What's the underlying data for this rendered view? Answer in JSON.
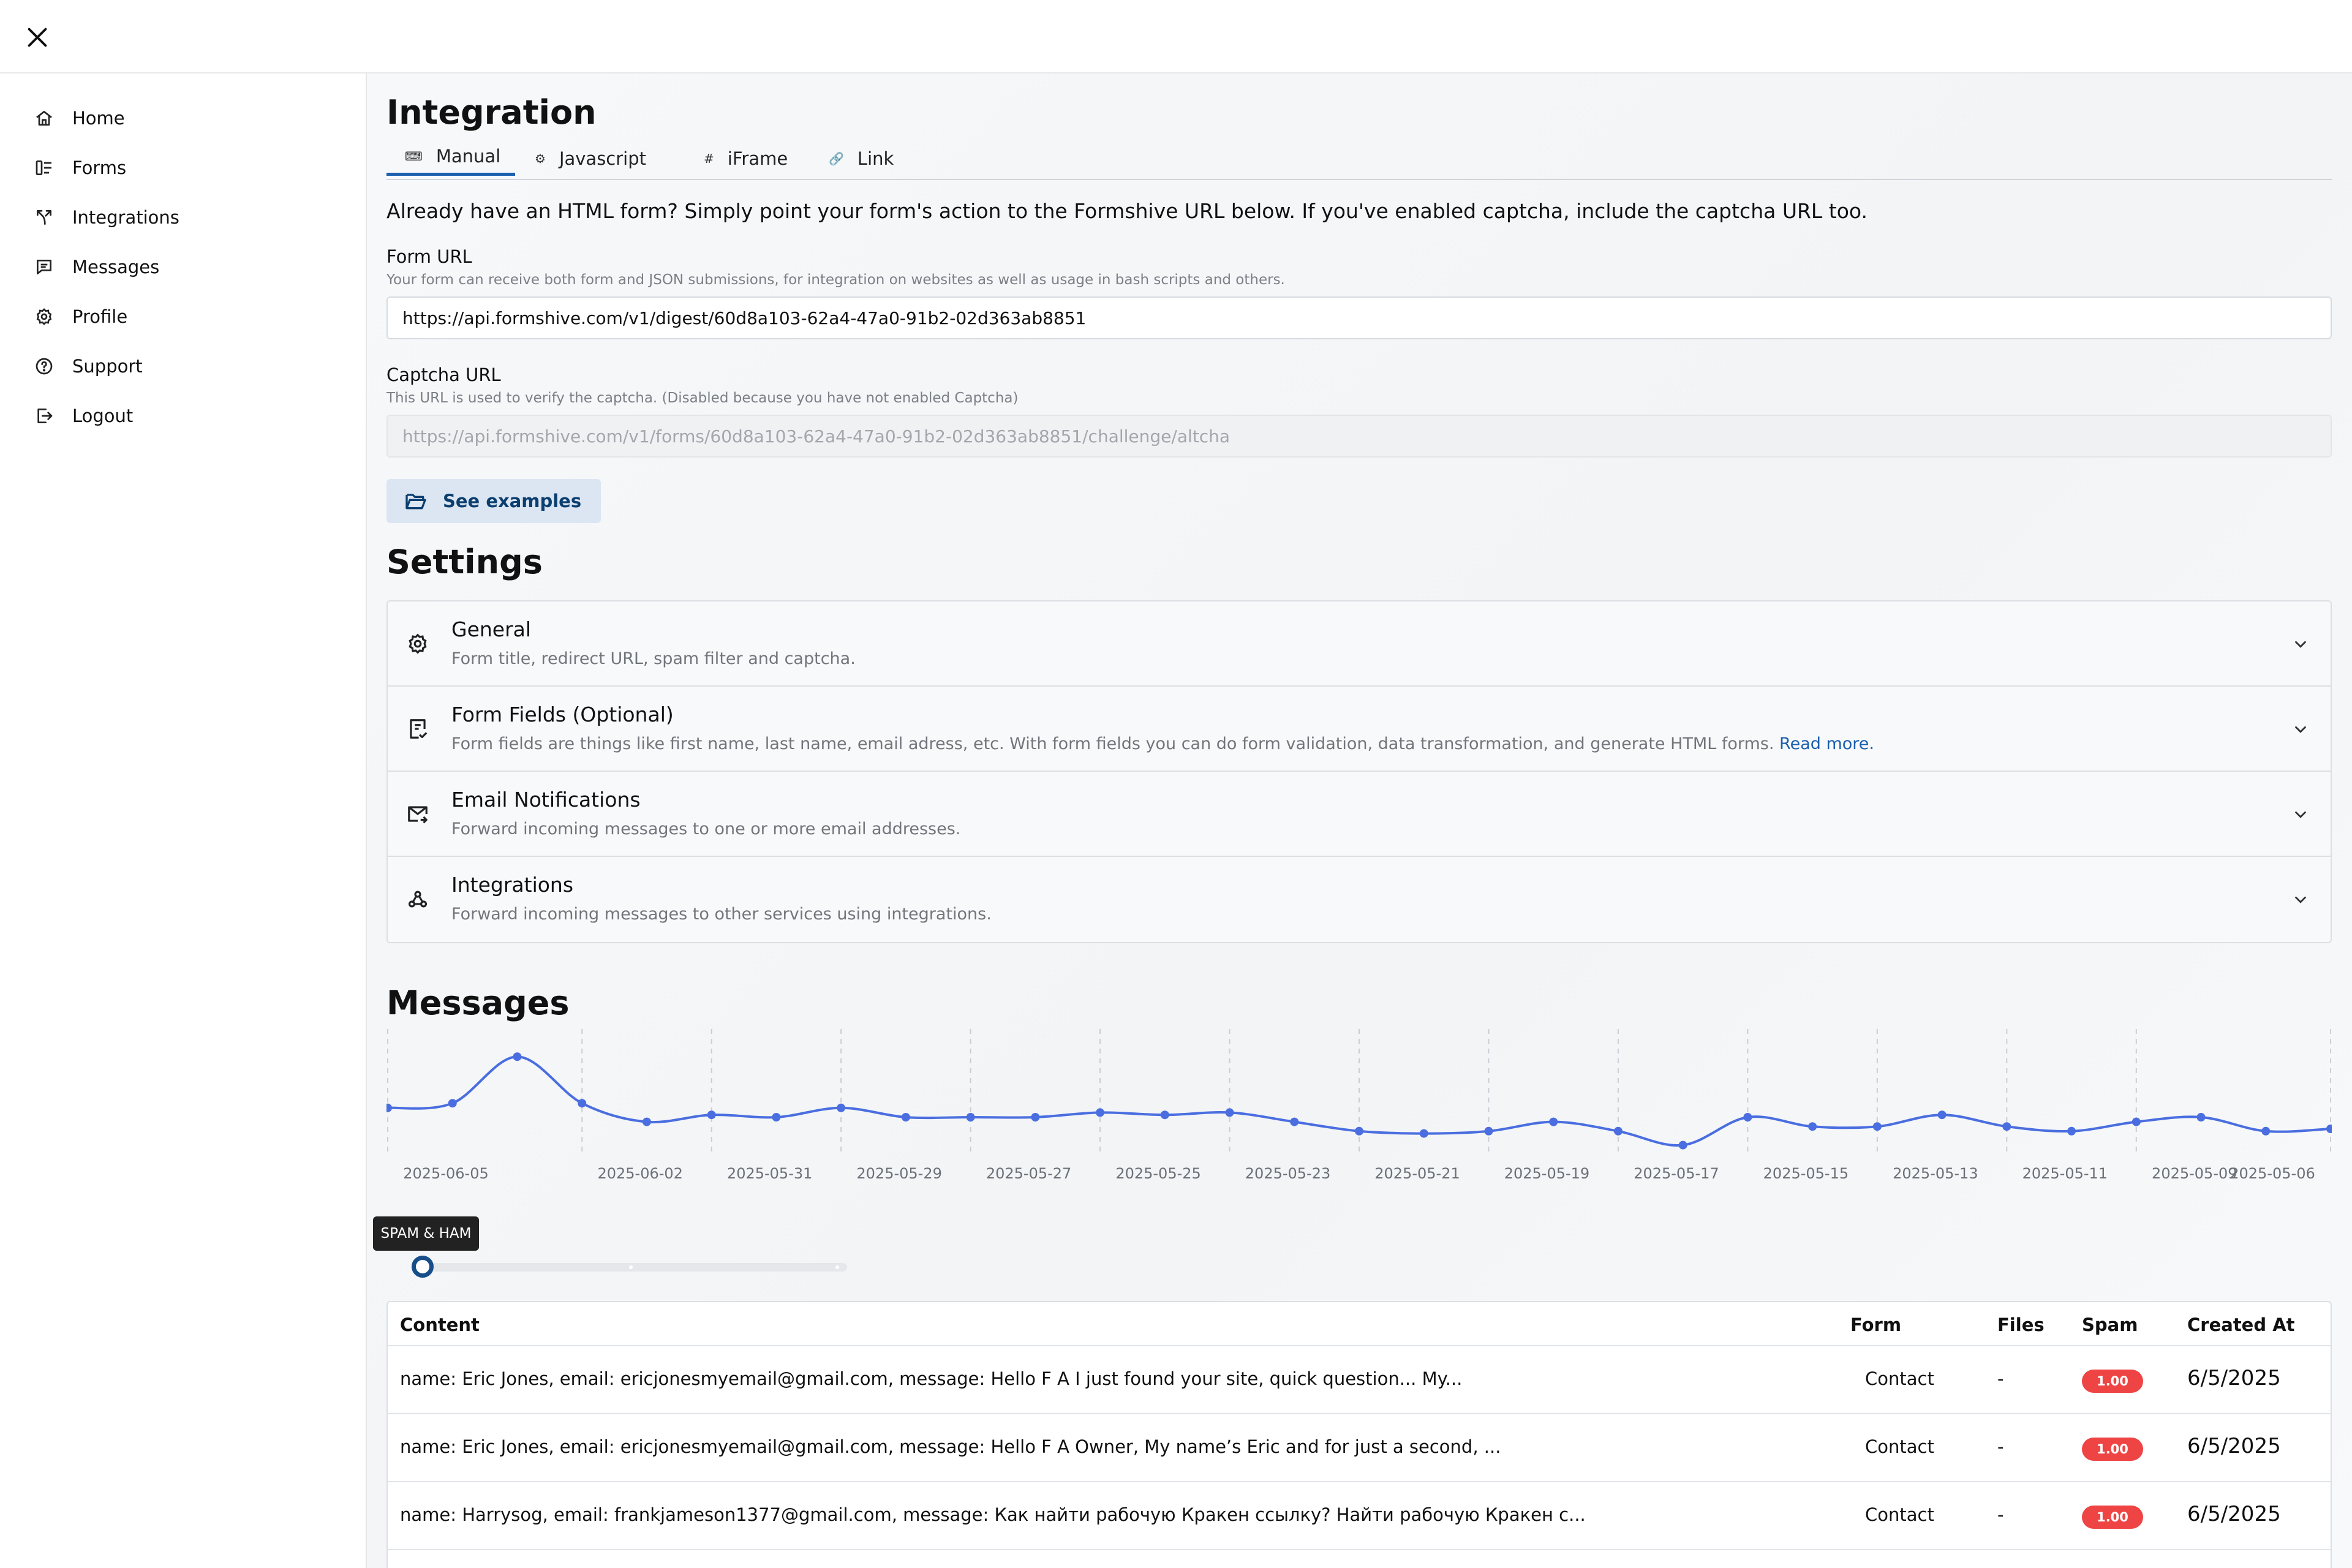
{
  "sidebar": {
    "items": [
      {
        "label": "Home",
        "icon": "home-icon"
      },
      {
        "label": "Forms",
        "icon": "forms-icon"
      },
      {
        "label": "Integrations",
        "icon": "integrations-icon"
      },
      {
        "label": "Messages",
        "icon": "messages-icon"
      },
      {
        "label": "Profile",
        "icon": "gear-icon"
      },
      {
        "label": "Support",
        "icon": "help-circle-icon"
      },
      {
        "label": "Logout",
        "icon": "logout-icon"
      }
    ]
  },
  "integration": {
    "title": "Integration",
    "tabs": [
      {
        "label": "Manual",
        "active": true
      },
      {
        "label": "Javascript"
      },
      {
        "label": "iFrame"
      },
      {
        "label": "Link"
      }
    ],
    "lead": "Already have an HTML form? Simply point your form's action to the Formshive URL below. If you've enabled captcha, include the captcha URL too.",
    "form_url_label": "Form URL",
    "form_url_help": "Your form can receive both form and JSON submissions, for integration on websites as well as usage in bash scripts and others.",
    "form_url_value": "https://api.formshive.com/v1/digest/60d8a103-62a4-47a0-91b2-02d363ab8851",
    "captcha_url_label": "Captcha URL",
    "captcha_url_help": "This URL is used to verify the captcha. (Disabled because you have not enabled Captcha)",
    "captcha_url_value": "https://api.formshive.com/v1/forms/60d8a103-62a4-47a0-91b2-02d363ab8851/challenge/altcha",
    "examples_button": "See examples"
  },
  "settings": {
    "title": "Settings",
    "sections": [
      {
        "title": "General",
        "desc": "Form title, redirect URL, spam filter and captcha.",
        "icon": "gear-icon"
      },
      {
        "title": "Form Fields (Optional)",
        "desc": "Form fields are things like first name, last name, email adress, etc. With form fields you can do form validation, data transformation, and generate HTML forms.",
        "link": "Read more.",
        "icon": "form-check-icon"
      },
      {
        "title": "Email Notifications",
        "desc": "Forward incoming messages to one or more email addresses.",
        "icon": "mail-forward-icon"
      },
      {
        "title": "Integrations",
        "desc": "Forward incoming messages to other services using integrations.",
        "icon": "webhook-icon"
      }
    ]
  },
  "messages": {
    "title": "Messages",
    "filter_label": "SPAM & HAM",
    "filter_value_index": 0,
    "table": {
      "columns": [
        "Content",
        "Form",
        "Files",
        "Spam",
        "Created At"
      ],
      "rows": [
        {
          "content": "name: Eric Jones, email: ericjonesmyemail@gmail.com, message: Hello F A  I just found your site, quick question...  My...",
          "form": "Contact",
          "files": "-",
          "spam": "1.00",
          "created": "6/5/2025"
        },
        {
          "content": "name: Eric Jones, email: ericjonesmyemail@gmail.com, message: Hello F A Owner,  My name’s Eric and for just a second, ...",
          "form": "Contact",
          "files": "-",
          "spam": "1.00",
          "created": "6/5/2025"
        },
        {
          "content": "name: Harrysog, email: frankjameson1377@gmail.com, message: Как найти рабочую Кракен ссылку?   Найти рабочую Кракен с...",
          "form": "Contact",
          "files": "-",
          "spam": "1.00",
          "created": "6/5/2025"
        }
      ]
    }
  },
  "colors": {
    "accent": "#1b5fae",
    "line": "#4a6ee0",
    "spam_badge": "#ef4444"
  },
  "chart_data": {
    "type": "line",
    "x": [
      "2025-06-05",
      "2025-06-04",
      "2025-06-03",
      "2025-06-02",
      "2025-06-01",
      "2025-05-31",
      "2025-05-30",
      "2025-05-29",
      "2025-05-28",
      "2025-05-27",
      "2025-05-26",
      "2025-05-25",
      "2025-05-24",
      "2025-05-23",
      "2025-05-22",
      "2025-05-21",
      "2025-05-20",
      "2025-05-19",
      "2025-05-18",
      "2025-05-17",
      "2025-05-16",
      "2025-05-15",
      "2025-05-14",
      "2025-05-13",
      "2025-05-12",
      "2025-05-11",
      "2025-05-10",
      "2025-05-09",
      "2025-05-08",
      "2025-05-07",
      "2025-05-06"
    ],
    "series": [
      {
        "values": [
          12,
          13,
          23,
          13,
          9,
          10.5,
          10,
          12,
          10,
          10,
          10,
          11,
          10.5,
          11,
          9,
          7,
          6.5,
          7,
          9,
          7,
          4,
          10,
          8,
          8,
          10.5,
          8,
          7,
          9,
          10,
          7,
          7.5
        ]
      }
    ],
    "x_tick_labels": [
      "2025-06-05",
      "2025-06-02",
      "2025-05-31",
      "2025-05-29",
      "2025-05-27",
      "2025-05-25",
      "2025-05-23",
      "2025-05-21",
      "2025-05-19",
      "2025-05-17",
      "2025-05-15",
      "2025-05-13",
      "2025-05-11",
      "2025-05-09",
      "2025-05-06"
    ],
    "ylim": [
      0,
      25
    ],
    "grid": "vertical-dashed",
    "legend": false
  }
}
